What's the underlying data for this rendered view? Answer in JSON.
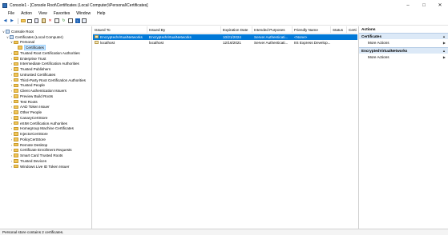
{
  "window": {
    "title": "Console1 - [Console Root\\Certificates (Local Computer)\\Personal\\Certificates]",
    "minimize_icon": "minimize-icon",
    "maximize_icon": "maximize-icon",
    "close_icon": "close-icon"
  },
  "menu": [
    "File",
    "Action",
    "View",
    "Favorites",
    "Window",
    "Help"
  ],
  "toolbar_icons": [
    "back-arrow-icon",
    "forward-arrow-icon",
    "up-folder-icon",
    "show-tree-icon",
    "copy-icon",
    "paste-icon",
    "delete-icon",
    "properties-icon",
    "refresh-icon",
    "export-icon",
    "help-icon",
    "show-action-pane-icon"
  ],
  "tree": {
    "items": [
      {
        "label": "Console Root",
        "level": 0,
        "expanded": true,
        "icon": "console-root-icon"
      },
      {
        "label": "Certificates (Local Computer)",
        "level": 1,
        "expanded": true,
        "icon": "certificates-snapin-icon"
      },
      {
        "label": "Personal",
        "level": 2,
        "expanded": true,
        "icon": "folder-icon"
      },
      {
        "label": "Certificates",
        "level": 3,
        "expanded": false,
        "icon": "folder-icon",
        "selected": true
      },
      {
        "label": "Trusted Root Certification Authorities",
        "level": 2,
        "expanded": false,
        "icon": "folder-icon"
      },
      {
        "label": "Enterprise Trust",
        "level": 2,
        "expanded": false,
        "icon": "folder-icon"
      },
      {
        "label": "Intermediate Certification Authorities",
        "level": 2,
        "expanded": false,
        "icon": "folder-icon"
      },
      {
        "label": "Trusted Publishers",
        "level": 2,
        "expanded": false,
        "icon": "folder-icon"
      },
      {
        "label": "Untrusted Certificates",
        "level": 2,
        "expanded": false,
        "icon": "folder-icon"
      },
      {
        "label": "Third-Party Root Certification Authorities",
        "level": 2,
        "expanded": false,
        "icon": "folder-icon"
      },
      {
        "label": "Trusted People",
        "level": 2,
        "expanded": false,
        "icon": "folder-icon"
      },
      {
        "label": "Client Authentication Issuers",
        "level": 2,
        "expanded": false,
        "icon": "folder-icon"
      },
      {
        "label": "Preview Build Roots",
        "level": 2,
        "expanded": false,
        "icon": "folder-icon"
      },
      {
        "label": "Test Roots",
        "level": 2,
        "expanded": false,
        "icon": "folder-icon"
      },
      {
        "label": "AAD Token Issuer",
        "level": 2,
        "expanded": false,
        "icon": "folder-icon"
      },
      {
        "label": "Other People",
        "level": 2,
        "expanded": false,
        "icon": "folder-icon"
      },
      {
        "label": "CanaryCertStore",
        "level": 2,
        "expanded": false,
        "icon": "folder-icon"
      },
      {
        "label": "eSIM Certification Authorities",
        "level": 2,
        "expanded": false,
        "icon": "folder-icon"
      },
      {
        "label": "Homegroup Machine Certificates",
        "level": 2,
        "expanded": false,
        "icon": "folder-icon"
      },
      {
        "label": "InjectorCertStore",
        "level": 2,
        "expanded": false,
        "icon": "folder-icon"
      },
      {
        "label": "PolicyCertStore",
        "level": 2,
        "expanded": false,
        "icon": "folder-icon"
      },
      {
        "label": "Remote Desktop",
        "level": 2,
        "expanded": false,
        "icon": "folder-icon"
      },
      {
        "label": "Certificate Enrollment Requests",
        "level": 2,
        "expanded": false,
        "icon": "folder-icon"
      },
      {
        "label": "Smart Card Trusted Roots",
        "level": 2,
        "expanded": false,
        "icon": "folder-icon"
      },
      {
        "label": "Trusted Devices",
        "level": 2,
        "expanded": false,
        "icon": "folder-icon"
      },
      {
        "label": "Windows Live ID Token Issuer",
        "level": 2,
        "expanded": false,
        "icon": "folder-icon"
      }
    ]
  },
  "list": {
    "columns": [
      "Issued To",
      "Issued By",
      "Expiration Date",
      "Intended Purposes",
      "Friendly Name",
      "Status",
      "Certi"
    ],
    "rows": [
      {
        "cells": [
          "EncryptedVirtualNetworks",
          "EncryptedVirtualNetworks",
          "10/21/2024",
          "Server Authenticati...",
          "<None>",
          "",
          ""
        ],
        "selected": true
      },
      {
        "cells": [
          "localhost",
          "localhost",
          "12/16/2021",
          "Server Authenticati...",
          "IIS Express Develop...",
          "",
          ""
        ],
        "selected": false
      }
    ]
  },
  "actions": {
    "title": "Actions",
    "sections": [
      {
        "label": "Certificates",
        "items": [
          "More Actions"
        ]
      },
      {
        "label": "EncryptedVirtualNetworks",
        "items": [
          "More Actions"
        ]
      }
    ]
  },
  "status": "Personal store contains 2 certificates."
}
